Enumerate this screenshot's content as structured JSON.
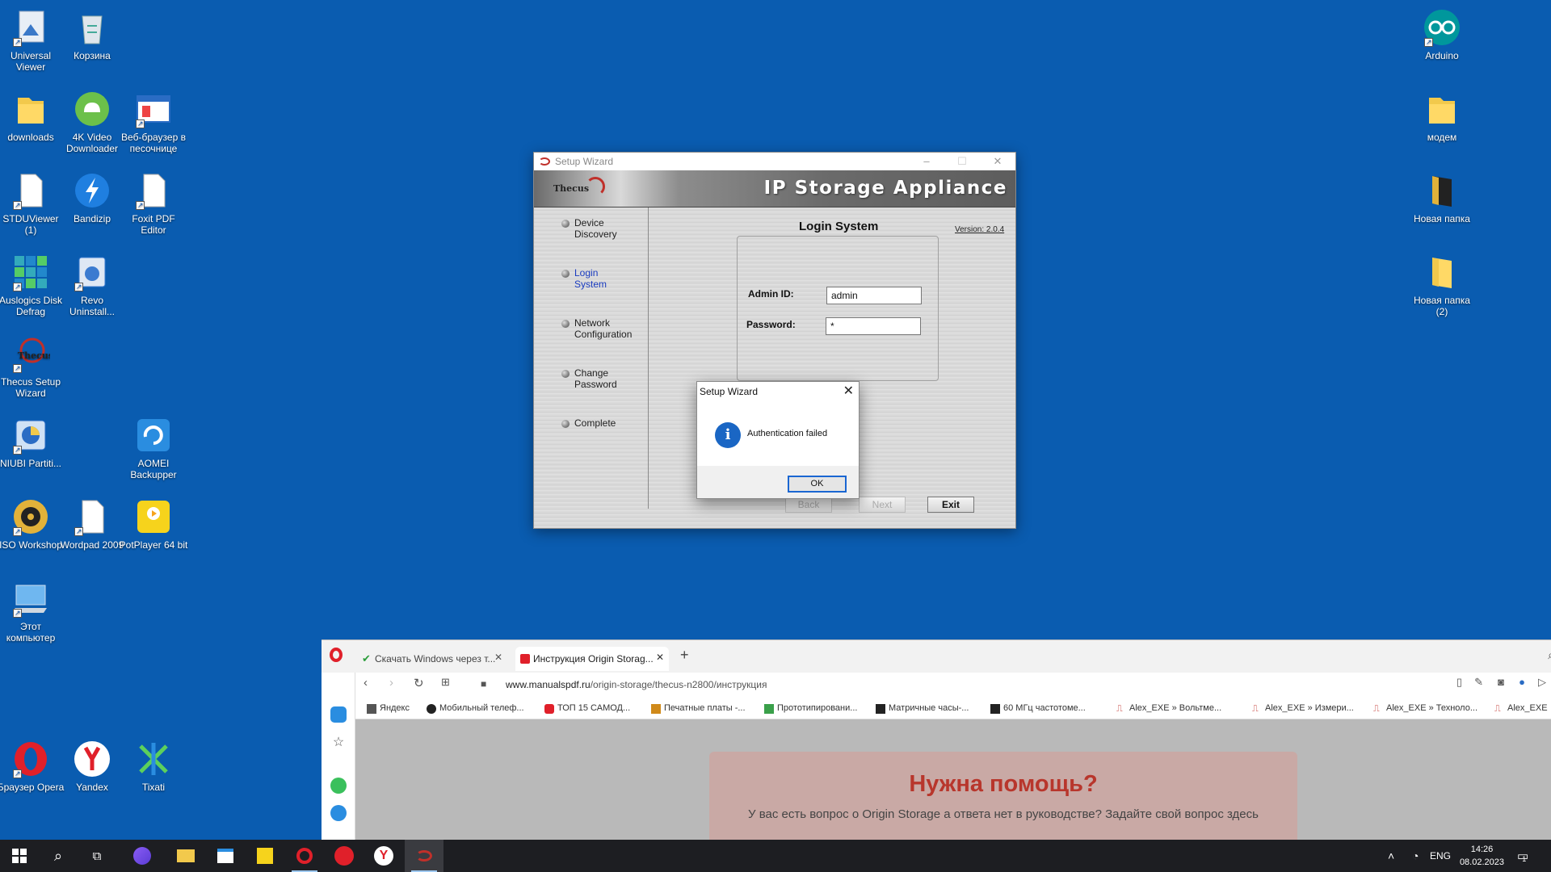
{
  "desktop": {
    "icons": [
      {
        "id": "universal-viewer",
        "label": "Universal Viewer"
      },
      {
        "id": "recycle-bin",
        "label": "Корзина"
      },
      {
        "id": "downloads",
        "label": "downloads"
      },
      {
        "id": "4k-video",
        "label": "4K Video Downloader"
      },
      {
        "id": "sandbox-browser",
        "label": "Веб-браузер в песочнице"
      },
      {
        "id": "stduviewer",
        "label": "STDUViewer (1)"
      },
      {
        "id": "bandizip",
        "label": "Bandizip"
      },
      {
        "id": "foxit",
        "label": "Foxit PDF Editor"
      },
      {
        "id": "auslogics",
        "label": "Auslogics Disk Defrag"
      },
      {
        "id": "revo",
        "label": "Revo Uninstall..."
      },
      {
        "id": "thecus",
        "label": "Thecus Setup Wizard"
      },
      {
        "id": "niubi",
        "label": "NIUBI Partiti..."
      },
      {
        "id": "aomei",
        "label": "AOMEI Backupper"
      },
      {
        "id": "iso-workshop",
        "label": "ISO Workshop"
      },
      {
        "id": "wordpad",
        "label": "Wordpad 2009"
      },
      {
        "id": "potplayer",
        "label": "PotPlayer 64 bit"
      },
      {
        "id": "this-pc",
        "label": "Этот компьютер"
      },
      {
        "id": "opera",
        "label": "Браузер Opera"
      },
      {
        "id": "yandex",
        "label": "Yandex"
      },
      {
        "id": "tixati",
        "label": "Tixati"
      },
      {
        "id": "arduino",
        "label": "Arduino"
      },
      {
        "id": "modem",
        "label": "модем"
      },
      {
        "id": "new-folder",
        "label": "Новая папка"
      },
      {
        "id": "new-folder-2",
        "label": "Новая папка (2)"
      }
    ]
  },
  "wizard": {
    "window_title": "Setup Wizard",
    "brand": "Thecus",
    "app_name": "IP Storage Appliance",
    "steps": [
      "Device Discovery",
      "Login System",
      "Network Configuration",
      "Change Password",
      "Complete"
    ],
    "active_step": "Login System",
    "page_title": "Login System",
    "version": "Version: 2.0.4",
    "admin_label": "Admin ID:",
    "admin_value": "admin",
    "password_label": "Password:",
    "password_value": "*",
    "back_label": "Back",
    "next_label": "Next",
    "exit_label": "Exit"
  },
  "dialog": {
    "title": "Setup Wizard",
    "message": "Authentication failed",
    "ok_label": "OK"
  },
  "browser": {
    "tabs": [
      {
        "title": "Скачать Windows через т...",
        "active": false
      },
      {
        "title": "Инструкция Origin Storag...",
        "active": true
      }
    ],
    "url_domain": "www.manualspdf.ru",
    "url_path": "/origin-storage/thecus-n2800/инструкция",
    "bookmarks": [
      "Яндекс",
      "Мобильный телеф...",
      "ТОП 15 САМОД...",
      "Печатные платы -...",
      "Прототипировани...",
      "Матричные часы-...",
      "60 МГц частотоме...",
      "Alex_EXE » Вольтме...",
      "Alex_EXE » Измери...",
      "Alex_EXE » Техноло...",
      "Alex_EXE"
    ],
    "help_title": "Нужна помощь?",
    "help_text": "У вас есть вопрос о Origin Storage а ответа нет в руководстве? Задайте свой вопрос здесь"
  },
  "taskbar": {
    "lang": "ENG",
    "time": "14:26",
    "date": "08.02.2023",
    "notifications": "1"
  },
  "colors": {
    "desktop": "#0a5cb0",
    "taskbar": "#1d1e22",
    "accent": "#1a66d2",
    "help_title": "#b8362c"
  }
}
